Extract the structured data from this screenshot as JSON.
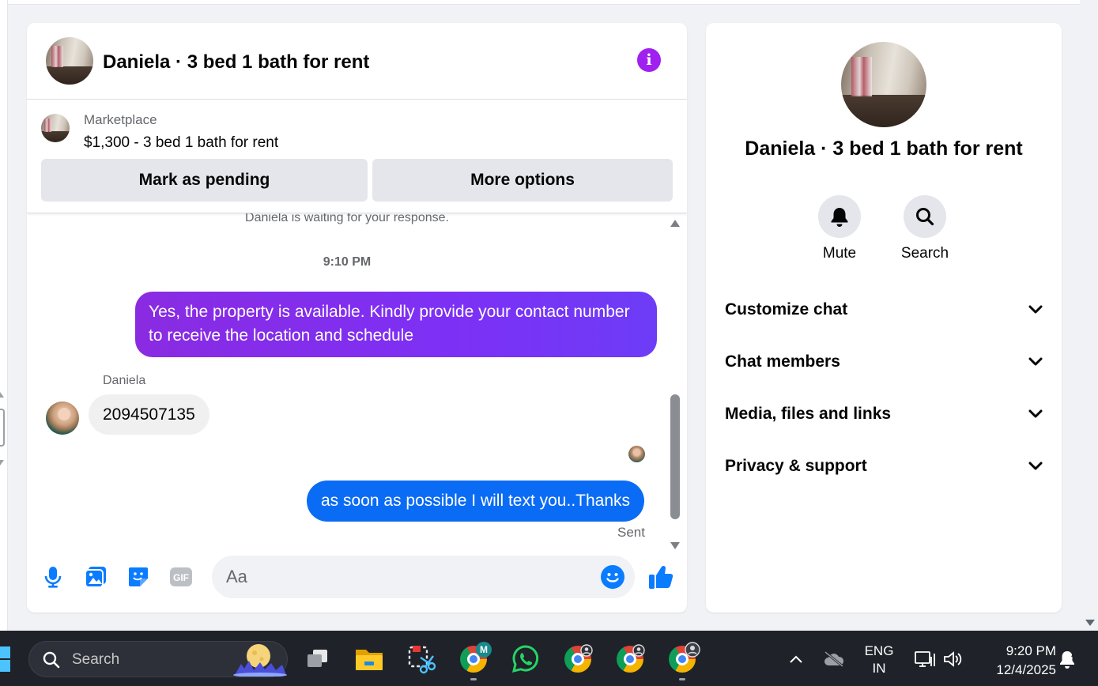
{
  "header": {
    "title": "Daniela · 3 bed 1 bath for rent",
    "info_icon": "info-icon"
  },
  "marketplace": {
    "label": "Marketplace",
    "listing": "$1,300 - 3 bed 1 bath for rent",
    "mark_pending_label": "Mark as pending",
    "more_options_label": "More options"
  },
  "messages": {
    "waiting_notice": "Daniela is waiting for your response.",
    "timestamp": "9:10 PM",
    "outgoing_1": "Yes, the property is available. Kindly provide your contact number to receive the location and schedule",
    "sender_name": "Daniela",
    "incoming_1": "2094507135",
    "outgoing_2": "as soon as possible I will text you..Thanks",
    "status": "Sent"
  },
  "composer": {
    "placeholder": "Aa",
    "icons": [
      "microphone-icon",
      "image-icon",
      "sticker-icon",
      "gif-icon",
      "emoji-icon",
      "thumbs-up-icon"
    ]
  },
  "side_panel": {
    "title": "Daniela · 3 bed 1 bath for rent",
    "actions": [
      {
        "label": "Mute",
        "icon": "bell-icon"
      },
      {
        "label": "Search",
        "icon": "search-icon"
      }
    ],
    "sections": [
      "Customize chat",
      "Chat members",
      "Media, files and links",
      "Privacy & support"
    ]
  },
  "taskbar": {
    "search_label": "Search",
    "chrome_badge": "M",
    "language_top": "ENG",
    "language_bottom": "IN",
    "time": "9:20 PM",
    "date": "12/4/2025"
  },
  "colors": {
    "accent_purple": "#a020f0",
    "bubble_purple": "#7d30f5",
    "bubble_blue": "#0a6cf5",
    "like_blue": "#0a7cff",
    "taskbar": "#1f2229"
  }
}
